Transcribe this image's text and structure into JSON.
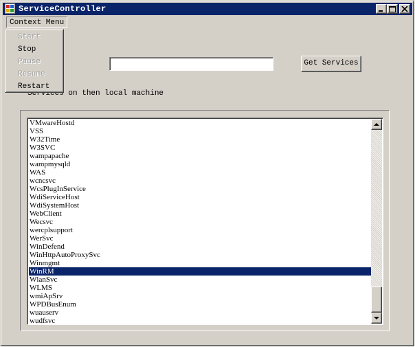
{
  "window": {
    "title": "ServiceController"
  },
  "menu": {
    "root_label": "Context Menu",
    "items": [
      {
        "label": "Start",
        "enabled": false
      },
      {
        "label": "Stop",
        "enabled": true
      },
      {
        "label": "Pause",
        "enabled": false
      },
      {
        "label": "Resume",
        "enabled": false
      },
      {
        "label": "Restart",
        "enabled": true
      }
    ]
  },
  "form": {
    "input_value": "",
    "get_services_label": "Get Services",
    "services_label": "Services on then local machine"
  },
  "services": {
    "items": [
      "VMwareHostd",
      "VSS",
      "W32Time",
      "W3SVC",
      "wampapache",
      "wampmysqld",
      "WAS",
      "wcncsvc",
      "WcsPlugInService",
      "WdiServiceHost",
      "WdiSystemHost",
      "WebClient",
      "Wecsvc",
      "wercplsupport",
      "WerSvc",
      "WinDefend",
      "WinHttpAutoProxySvc",
      "Winmgmt",
      "WinRM",
      "WlanSvc",
      "WLMS",
      "wmiApSrv",
      "WPDBusEnum",
      "wuauserv",
      "wudfsvc"
    ],
    "selected": "WinRM"
  },
  "colors": {
    "titlebar": "#0a246a",
    "face": "#d4d0c8",
    "selection": "#0a246a"
  }
}
